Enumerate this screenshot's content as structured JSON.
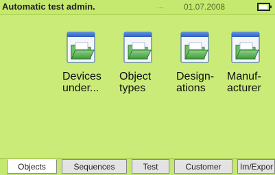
{
  "title_bar": {
    "title": "Automatic test admin.",
    "dots": "...",
    "date": "01.07.2008"
  },
  "items": [
    {
      "line1": "Devices",
      "line2": "under...",
      "icon": "folder-icon"
    },
    {
      "line1": "Object",
      "line2": "types",
      "icon": "folder-icon"
    },
    {
      "line1": "Design-",
      "line2": "ations",
      "icon": "folder-icon"
    },
    {
      "line1": "Manuf-",
      "line2": "acturer",
      "icon": "folder-icon"
    }
  ],
  "tabs": [
    "Objects",
    "Sequences",
    "Test",
    "Customer",
    "Im/Expor"
  ],
  "active_tab": "Objects",
  "colors": {
    "background": "#caeb78",
    "title_bar": "#c5e86f",
    "tab_active": "#ffffff",
    "tab_inactive": "#e3e3e3"
  }
}
